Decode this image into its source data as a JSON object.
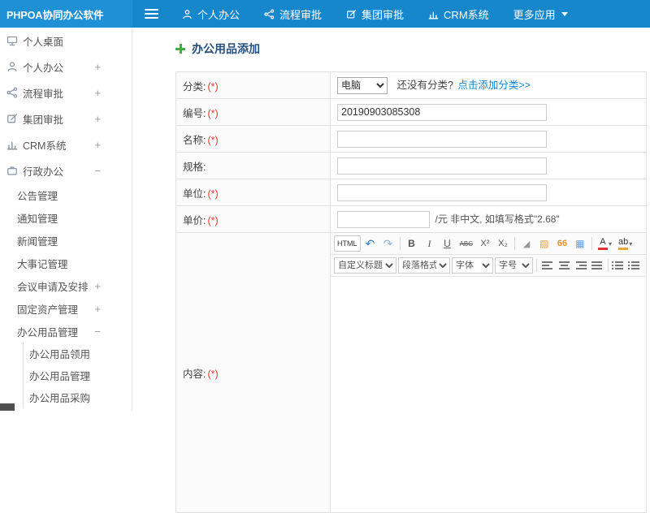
{
  "app": {
    "logo": "PHPOA协同办公软件"
  },
  "topnav": {
    "items": [
      {
        "label": "个人办公"
      },
      {
        "label": "流程审批"
      },
      {
        "label": "集团审批"
      },
      {
        "label": "CRM系统"
      },
      {
        "label": "更多应用"
      }
    ]
  },
  "sidebar": {
    "items": [
      {
        "label": "个人桌面",
        "expand": ""
      },
      {
        "label": "个人办公",
        "expand": "+"
      },
      {
        "label": "流程审批",
        "expand": "+"
      },
      {
        "label": "集团审批",
        "expand": "+"
      },
      {
        "label": "CRM系统",
        "expand": "+"
      },
      {
        "label": "行政办公",
        "expand": "−"
      }
    ],
    "admin_children": [
      {
        "label": "公告管理",
        "expand": ""
      },
      {
        "label": "通知管理",
        "expand": ""
      },
      {
        "label": "新闻管理",
        "expand": ""
      },
      {
        "label": "大事记管理",
        "expand": ""
      },
      {
        "label": "会议申请及安排",
        "expand": "+"
      },
      {
        "label": "固定资产管理",
        "expand": "+"
      },
      {
        "label": "办公用品管理",
        "expand": "−"
      }
    ],
    "supplies_children": [
      {
        "label": "办公用品领用"
      },
      {
        "label": "办公用品管理"
      },
      {
        "label": "办公用品采购"
      }
    ]
  },
  "page": {
    "title": "办公用品添加"
  },
  "form": {
    "category": {
      "label": "分类:",
      "req": "(*)",
      "value": "电脑",
      "hint": "还没有分类?",
      "link": "点击添加分类>>"
    },
    "code": {
      "label": "编号:",
      "req": "(*)",
      "value": "20190903085308"
    },
    "name": {
      "label": "名称:",
      "req": "(*)"
    },
    "spec": {
      "label": "规格:"
    },
    "unit": {
      "label": "单位:",
      "req": "(*)"
    },
    "price": {
      "label": "单价:",
      "req": "(*)",
      "suffix": "/元 非中文, 如填写格式\"2.68\""
    },
    "content": {
      "label": "内容:",
      "req": "(*)"
    }
  },
  "editor": {
    "buttons": {
      "html": "HTML",
      "bold": "B",
      "italic": "I",
      "underline": "U",
      "strikethrough": "ABC",
      "superscript": "X²",
      "subscript": "X₂",
      "fontcolor": "A",
      "bgcolor": "ab"
    },
    "icons": {
      "undo": "↶",
      "redo": "↷",
      "eraser": "◢",
      "brush": "▨",
      "quote": "66",
      "grid": "▦",
      "caret": "▾"
    },
    "selects": {
      "style": "自定义标题",
      "paragraph": "段落格式",
      "font": "字体",
      "size": "字号"
    }
  },
  "colors": {
    "topbar": "#1787cb",
    "logo_bg": "#2090d5",
    "accent_green": "#3fae49",
    "link": "#1787cb",
    "required": "#e53935"
  }
}
